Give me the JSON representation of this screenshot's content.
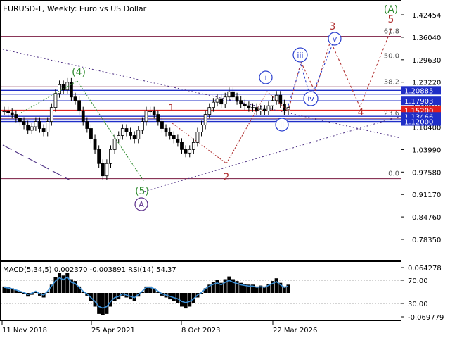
{
  "title": "EURUSD-T, Weekly:  Euro vs US Dollar",
  "main_axis": {
    "ticks": [
      "1.42454",
      "1.36040",
      "1.29630",
      "1.23220",
      "1.16810",
      "1.10400",
      "1.03990",
      "0.97580",
      "0.91170",
      "0.84760",
      "0.78350"
    ],
    "ylim": [
      0.743,
      1.45
    ]
  },
  "price_tags": [
    {
      "value": "1.20885",
      "bg": "#1f2ec7"
    },
    {
      "value": "1.17903",
      "bg": "#1f2ec7"
    },
    {
      "value": "1.15200",
      "bg": "#e02020"
    },
    {
      "value": "1.13466",
      "bg": "#1f2ec7"
    },
    {
      "value": "1.12000",
      "bg": "#1f2ec7"
    }
  ],
  "fib_levels": [
    {
      "label": "61.8",
      "price": 1.363
    },
    {
      "label": "50.0",
      "price": 1.293
    },
    {
      "label": "38.2",
      "price": 1.219
    },
    {
      "label": "23.6",
      "price": 1.129
    },
    {
      "label": "0.0",
      "price": 0.957
    }
  ],
  "time_axis": [
    "11 Nov 2018",
    "25 Apr 2021",
    "8 Oct 2023",
    "22 Mar 2026"
  ],
  "wave_labels": {
    "A_top": "(A)",
    "w4": "(4)",
    "w5": "(5)",
    "A_bottom": "A",
    "r1": "1",
    "r2": "2",
    "r3": "3",
    "r4": "4",
    "r5": "5",
    "wi": "i",
    "wii": "ii",
    "wiii": "iii",
    "wiv": "iv",
    "wv": "v"
  },
  "indicator": {
    "label": "MACD(5,34,5) 0.002370 -0.003891 RSI(14) 54.37",
    "ticks": [
      "0.064278",
      "70.00",
      "30.00",
      "-0.069779"
    ]
  },
  "colors": {
    "candles": "#000000",
    "support_lines": "#1f2ec7",
    "current_line": "#e02020",
    "fib_lines": "#7a1a40",
    "wave_green": "#2e8b2e",
    "wave_red": "#b03030",
    "wave_blue": "#2a3fcf",
    "wave_purple": "#5a2d8a",
    "rsi": "#3b8fd6"
  },
  "chart_data": {
    "type": "candlestick",
    "symbol": "EURUSD-T",
    "timeframe": "Weekly",
    "series_close": [
      1.15,
      1.145,
      1.14,
      1.13,
      1.12,
      1.11,
      1.095,
      1.105,
      1.12,
      1.1,
      1.09,
      1.12,
      1.16,
      1.2,
      1.225,
      1.21,
      1.232,
      1.19,
      1.18,
      1.15,
      1.12,
      1.1,
      1.07,
      1.04,
      1.0,
      0.965,
      1.0,
      1.04,
      1.07,
      1.08,
      1.1,
      1.09,
      1.08,
      1.07,
      1.095,
      1.12,
      1.15,
      1.15,
      1.14,
      1.12,
      1.1,
      1.09,
      1.08,
      1.07,
      1.06,
      1.04,
      1.03,
      1.04,
      1.06,
      1.09,
      1.11,
      1.14,
      1.16,
      1.175,
      1.185,
      1.17,
      1.19,
      1.205,
      1.19,
      1.18,
      1.17,
      1.165,
      1.16,
      1.16,
      1.15,
      1.155,
      1.15,
      1.165,
      1.18,
      1.195,
      1.17,
      1.15,
      1.16
    ]
  }
}
